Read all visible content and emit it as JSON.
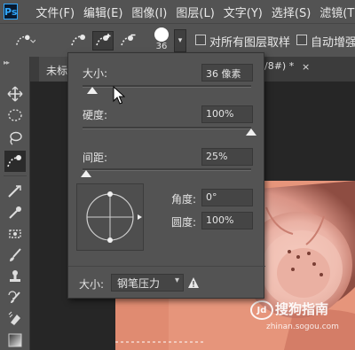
{
  "app": {
    "logo": "Ps",
    "menu": [
      "文件(F)",
      "编辑(E)",
      "图像(I)",
      "图层(L)",
      "文字(Y)",
      "选择(S)",
      "滤镜(T)"
    ]
  },
  "options_bar": {
    "brush_size_value": "36",
    "sample_all_layers_label": "对所有图层取样",
    "auto_enhance_label": "自动增强"
  },
  "tabs": {
    "left_title": "未标",
    "right_title": "/8#) *",
    "close_symbol": "×"
  },
  "brush_popup": {
    "size_label": "大小:",
    "size_value": "36 像素",
    "size_fraction": 0.06,
    "hardness_label": "硬度:",
    "hardness_value": "100%",
    "hardness_fraction": 1.0,
    "spacing_label": "间距:",
    "spacing_value": "25%",
    "spacing_fraction": 0.02,
    "angle_label": "角度:",
    "angle_value": "0°",
    "roundness_label": "圆度:",
    "roundness_value": "100%",
    "pressure_label": "大小:",
    "pressure_value": "钢笔压力"
  },
  "watermark": {
    "icon_text": "Jd",
    "text": "搜狗指南",
    "url": "zhinan.sogou.com"
  },
  "colors": {
    "ui_panel": "#535353",
    "ui_dark": "#282828",
    "canvas_bg": "#e6957b"
  }
}
